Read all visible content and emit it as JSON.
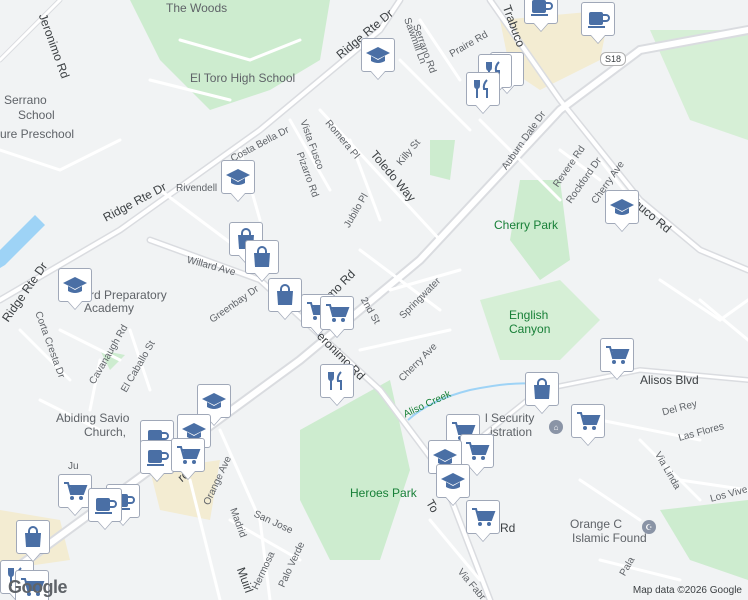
{
  "map": {
    "labels": {
      "the_woods": "The Woods",
      "el_toro_high": "El Toro High School",
      "serrano_school_1": "Serrano",
      "serrano_school_2": "School",
      "preschool": "ure Preschool",
      "ridge_rte_dr_1": "Ridge Rte Dr",
      "ridge_rte_dr_2": "Ridge Rte Dr",
      "ridge_rte_dr_3": "Ridge Rte Dr",
      "jeronimo_rd_1": "Jeronimo Rd",
      "jeronimo_rd_2": "Jeronimo Rd",
      "jeronimo_rd_3": "eronimo Rd",
      "trabuco_1": "Trabuco",
      "trabuco_2": "buco Rd",
      "toledo_way": "Toledo Way",
      "cherry_park": "Cherry Park",
      "english_canyon_1": "English",
      "english_canyon_2": "Canyon",
      "heroes_park": "Heroes Park",
      "aliso_creek": "Aliso Creek",
      "alisos_blvd": "Alisos Blvd",
      "sawmill_ln": "Sawmill Ln",
      "serrano_rd": "Serrano Rd",
      "praire_rd": "Praire Rd",
      "costa_bella_dr": "Costa Bella Dr",
      "vista_fusco": "Vista Fusco",
      "romera_pl": "Romera Pl",
      "killy_st": "Killy St",
      "pizarro_rd": "Pizarro Rd",
      "rivendell": "Rivendell",
      "jubilo_pl": "Jubilo Pl",
      "auburn_dale_dr": "Auburn Dale Dr",
      "revere_rd": "Revere Rd",
      "rockford_dr": "Rockford Dr",
      "cherry_ave_1": "Cherry Ave",
      "cherry_ave_2": "Cherry Ave",
      "willard_ave": "Willard Ave",
      "greenbay_dr": "Greenbay Dr",
      "2nd_st": "2nd St",
      "springwater": "Springwater",
      "corta_cresta_dr": "Corta Cresta Dr",
      "cavanaugh_rd": "Cavanaugh Rd",
      "el_caballo_st": "El Caballo St",
      "oxford_1": "xford Preparatory",
      "oxford_2": "Academy",
      "abiding_1": "Abiding Savio",
      "abiding_2": "Church,",
      "social_security_1": "l Security",
      "social_security_2": "istration",
      "del_rey": "Del Rey",
      "las_flores": "Las Flores",
      "via_linda": "Via Linda",
      "los_vive": "Los Vive",
      "orange_ave": "Orange Ave",
      "madrid": "Madrid",
      "san_jose": "San Jose",
      "hermosa": "Hermosa",
      "palo_verde": "Palo Verde",
      "muirl": "Muirl",
      "orange_islamic_1": "Orange C",
      "orange_islamic_2": "Islamic Found",
      "pala": "Pala",
      "via_fabr": "Via Fabr",
      "toro_rd": "To",
      "rd_frag": "Rd",
      "ju": "Ju",
      "toro_frag": "ro",
      "s18": "S18",
      "attribution": "Map data ©2026 Google",
      "google": "Google"
    },
    "markers": [
      {
        "icon": "coffee-icon",
        "category": "cafe"
      },
      {
        "icon": "coffee-icon",
        "category": "cafe"
      },
      {
        "icon": "school-icon",
        "category": "school"
      },
      {
        "icon": "restaurant-icon",
        "category": "restaurant"
      },
      {
        "icon": "restaurant-icon",
        "category": "restaurant"
      },
      {
        "icon": "restaurant-icon",
        "category": "restaurant"
      },
      {
        "icon": "school-icon",
        "category": "school"
      },
      {
        "icon": "school-icon",
        "category": "school"
      },
      {
        "icon": "shopping-bag-icon",
        "category": "store"
      },
      {
        "icon": "shopping-bag-icon",
        "category": "store"
      },
      {
        "icon": "shopping-bag-icon",
        "category": "store"
      },
      {
        "icon": "school-icon",
        "category": "school"
      },
      {
        "icon": "shopping-cart-icon",
        "category": "grocery"
      },
      {
        "icon": "shopping-cart-icon",
        "category": "grocery"
      },
      {
        "icon": "restaurant-icon",
        "category": "restaurant"
      },
      {
        "icon": "shopping-cart-icon",
        "category": "grocery"
      },
      {
        "icon": "shopping-bag-icon",
        "category": "store"
      },
      {
        "icon": "shopping-cart-icon",
        "category": "grocery"
      },
      {
        "icon": "school-icon",
        "category": "school"
      },
      {
        "icon": "coffee-icon",
        "category": "cafe"
      },
      {
        "icon": "school-icon",
        "category": "school"
      },
      {
        "icon": "coffee-icon",
        "category": "cafe"
      },
      {
        "icon": "shopping-cart-icon",
        "category": "grocery"
      },
      {
        "icon": "shopping-cart-icon",
        "category": "grocery"
      },
      {
        "icon": "shopping-cart-icon",
        "category": "grocery"
      },
      {
        "icon": "shopping-cart-icon",
        "category": "grocery"
      },
      {
        "icon": "coffee-icon",
        "category": "cafe"
      },
      {
        "icon": "coffee-icon",
        "category": "cafe"
      },
      {
        "icon": "shopping-bag-icon",
        "category": "store"
      },
      {
        "icon": "restaurant-icon",
        "category": "restaurant"
      },
      {
        "icon": "shopping-cart-icon",
        "category": "grocery"
      },
      {
        "icon": "school-icon",
        "category": "school"
      },
      {
        "icon": "school-icon",
        "category": "school"
      },
      {
        "icon": "shopping-cart-icon",
        "category": "grocery"
      }
    ],
    "colors": {
      "background": "#f1f3f4",
      "park": "#cdeccf",
      "road": "#ffffff",
      "major_road": "#dadce0",
      "commercial": "#f3ecd2",
      "water": "#9ed3f6"
    }
  }
}
